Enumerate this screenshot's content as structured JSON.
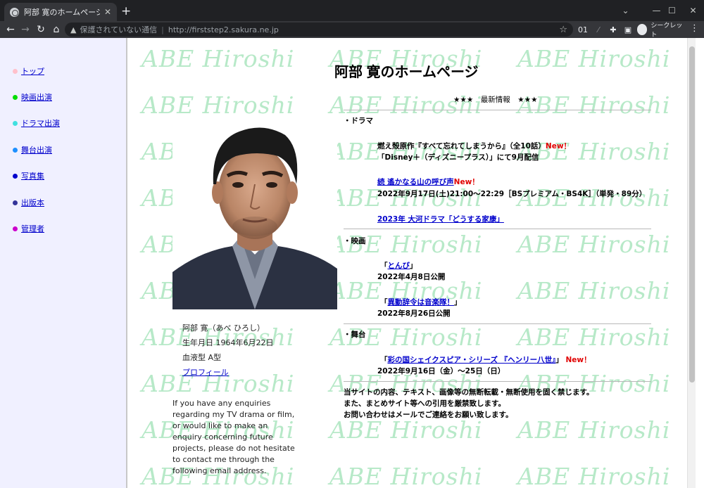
{
  "browser": {
    "tab_title": "阿部 寛のホームページ",
    "tab_close": "✕",
    "new_tab": "+",
    "security_label": "保護されていない通信",
    "url": "http://firststep2.sakura.ne.jp",
    "incognito_label": "シークレット",
    "ext_count": "01"
  },
  "sidebar": {
    "items": [
      {
        "label": "トップ",
        "color": "#ffc0cb"
      },
      {
        "label": "映画出演",
        "color": "#00dd00"
      },
      {
        "label": "ドラマ出演",
        "color": "#40e0e0"
      },
      {
        "label": "舞台出演",
        "color": "#1e90ff"
      },
      {
        "label": "写真集",
        "color": "#0000cc"
      },
      {
        "label": "出版本",
        "color": "#333399"
      },
      {
        "label": "管理者",
        "color": "#cc00cc"
      }
    ]
  },
  "watermark_text": "ABE Hiroshi",
  "page": {
    "title": "阿部 寛のホームページ",
    "latest_heading": "★★★　最新情報　★★★"
  },
  "profile": {
    "name": "阿部 寛（あべ ひろし）",
    "birthday": "生年月日 1964年6月22日",
    "blood": "血液型 A型",
    "profile_link": "プロフィール"
  },
  "enquiry_text": "If you have any enquiries regarding my TV drama or film, or would like to make an enquiry concerning future projects, please do not hesitate to contact me through the following email address.",
  "news": {
    "drama_heading": "・ドラマ",
    "drama1_title": "燃え殻原作『すべて忘れてしまうから』（全10話）",
    "drama1_note": "「Disney＋（ディズニープラス）」にて9月配信",
    "drama2_title": "続 遙かなる山の呼び声",
    "drama2_note": "2022年9月17日(土)21:00～22:29［BSプレミアム・BS4K］（単発・89分）",
    "drama3_title": "2023年 大河ドラマ「どうする家康」",
    "movie_heading": "・映画",
    "movie1_title": "とんび",
    "movie1_note": "2022年4月8日公開",
    "movie2_title": "異動辞令は音楽隊！",
    "movie2_note": "2022年8月26日公開",
    "stage_heading": "・舞台",
    "stage1_title": "彩の国シェイクスピア・シリーズ 『ヘンリー八世』",
    "stage1_note": "2022年9月16日（金）～25日（日）",
    "new_label": "New！",
    "open_bracket": "「",
    "close_bracket": "」",
    "notice1": "当サイトの内容、テキスト、画像等の無断転載・無断使用を固く禁じます。",
    "notice2": "また、まとめサイト等への引用を厳禁致します。",
    "notice3": "お問い合わせはメールでご連絡をお願い致します。"
  }
}
